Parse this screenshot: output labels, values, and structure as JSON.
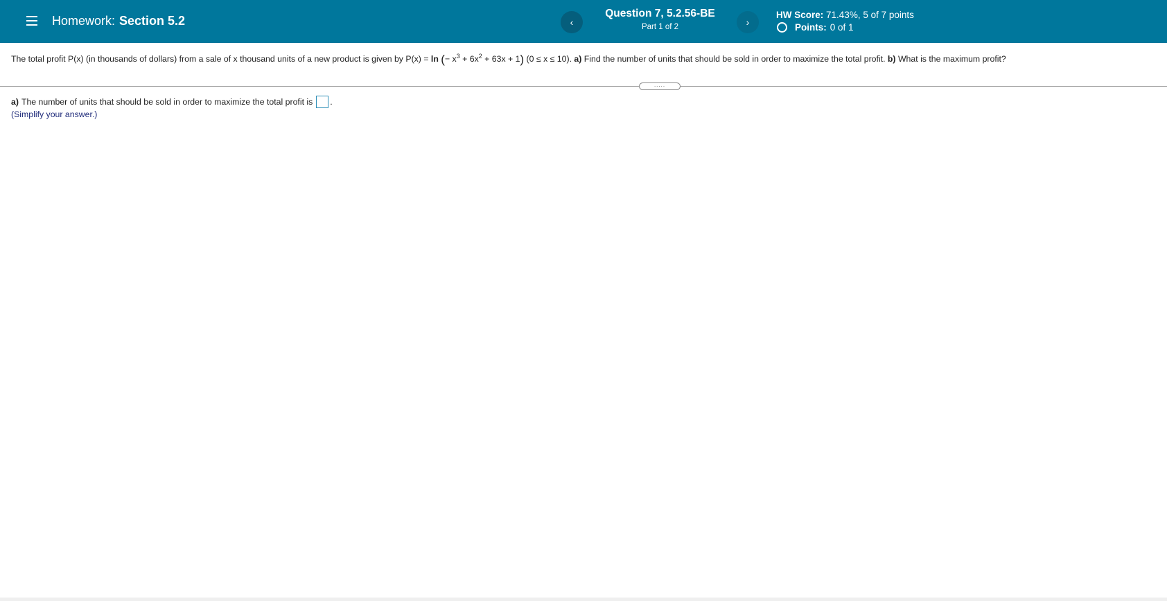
{
  "header": {
    "homework_prefix": "Homework:",
    "section_label": "Section 5.2",
    "prev_label": "‹",
    "next_label": "›",
    "question_title": "Question 7, 5.2.56-BE",
    "part_label": "Part 1 of 2",
    "hw_score_label": "HW Score:",
    "hw_score_value": "71.43%, 5 of 7 points",
    "points_label": "Points:",
    "points_value": "0 of 1"
  },
  "question": {
    "intro": "The total profit P(x) (in thousands of dollars) from a sale of x thousand units of a new product is given by P(x) =",
    "func_name": "ln",
    "poly_1": "− x",
    "poly_exp1": "3",
    "poly_2": "+ 6x",
    "poly_exp2": "2",
    "poly_3": "+ 63x + 1",
    "domain": "(0 ≤ x ≤ 10).",
    "part_a_label": "a)",
    "part_a_text": "Find the number of units that should be sold in order to maximize the total profit.",
    "part_b_label": "b)",
    "part_b_text": "What is the maximum profit?"
  },
  "more_handle": ".....",
  "answer": {
    "part_label": "a)",
    "prompt": "The number of units that should be sold in order to maximize the total profit is",
    "trailing": ".",
    "hint": "(Simplify your answer.)"
  },
  "colors": {
    "header_bg": "#00779c",
    "nav_button": "#055e7c",
    "hint_text": "#1f2b7a",
    "answer_box_border": "#2e8fb7"
  }
}
